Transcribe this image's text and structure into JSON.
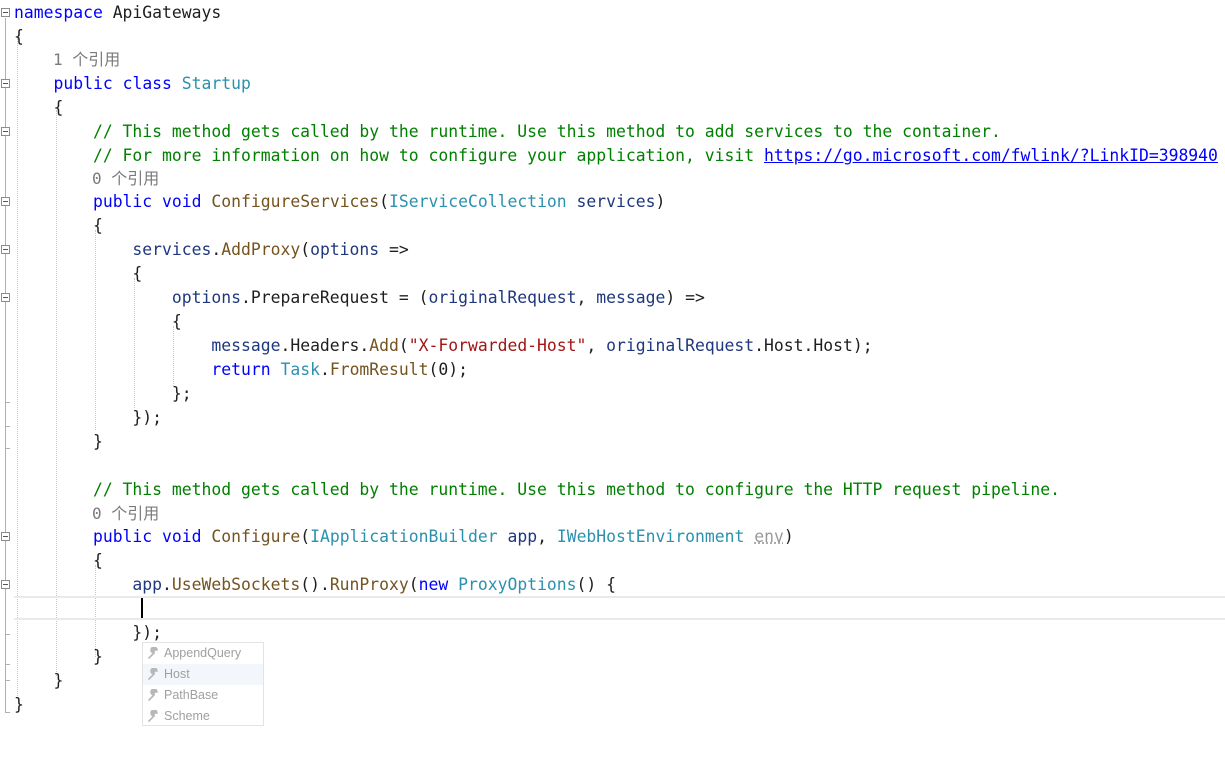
{
  "code": {
    "ns_keyword": "namespace",
    "ns_name": "ApiGateways",
    "open_brace": "{",
    "close_brace": "}",
    "lens_class": "1 个引用",
    "lens_configure_services": "0 个引用",
    "lens_configure": "0 个引用",
    "kw_public": "public",
    "kw_class": "class",
    "class_name": "Startup",
    "comment1": "// This method gets called by the runtime. Use this method to add services to the container.",
    "comment2_prefix": "// For more information on how to configure your application, visit ",
    "comment2_link": "https://go.microsoft.com/fwlink/?LinkID=398940",
    "kw_void": "void",
    "method_configure_services": "ConfigureServices",
    "type_iservicecollection": "IServiceCollection",
    "param_services": "services",
    "id_services": "services",
    "method_addproxy": "AddProxy",
    "param_options": "options",
    "id_options": "options",
    "prop_preparerequest": "PrepareRequest",
    "param_original": "originalRequest",
    "param_message": "message",
    "id_message": "message",
    "prop_headers": "Headers",
    "method_add": "Add",
    "str_header": "\"X-Forwarded-Host\"",
    "id_original": "originalRequest",
    "prop_host": "Host",
    "kw_return": "return",
    "type_task": "Task",
    "method_fromresult": "FromResult",
    "lambda_close": "};",
    "call_close": "});",
    "comment3": "// This method gets called by the runtime. Use this method to configure the HTTP request pipeline.",
    "method_configure": "Configure",
    "type_iappbuilder": "IApplicationBuilder",
    "param_app": "app",
    "type_iwebhost": "IWebHostEnvironment",
    "param_env": "env",
    "id_app": "app",
    "method_usewebsockets": "UseWebSockets",
    "method_runproxy": "RunProxy",
    "kw_new": "new",
    "type_proxyoptions": "ProxyOptions"
  },
  "completion": {
    "items": [
      "AppendQuery",
      "Host",
      "PathBase",
      "Scheme"
    ],
    "selected": "Host",
    "icon": "wrench-icon"
  },
  "colors": {
    "keyword": "#0000ff",
    "type": "#2b91af",
    "comment": "#008000",
    "string": "#a31515",
    "identifier": "#1f377f",
    "method": "#74531f"
  }
}
